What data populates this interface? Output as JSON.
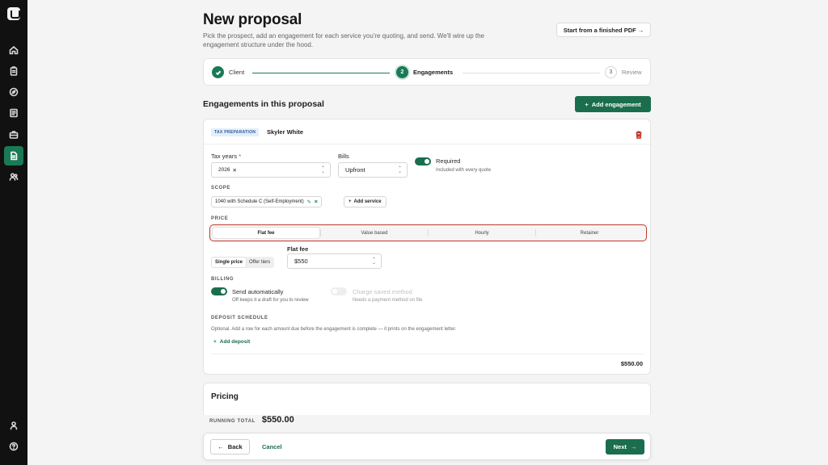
{
  "header": {
    "title": "New proposal",
    "subtitle": "Pick the prospect, add an engagement for each service you're quoting, and send. We'll wire up the engagement structure under the hood.",
    "pdf_button": "Start from a finished PDF →"
  },
  "stepper": {
    "steps": [
      {
        "label": "Client",
        "number": "",
        "state": "done"
      },
      {
        "label": "Engagements",
        "number": "2",
        "state": "current"
      },
      {
        "label": "Review",
        "number": "3",
        "state": "todo"
      }
    ]
  },
  "engagements": {
    "section_title": "Engagements in this proposal",
    "add_button": "Add engagement",
    "card": {
      "badge": "TAX PREPARATION",
      "client": "Skyler White",
      "tax_years_label": "Tax years",
      "tax_years_required_mark": "*",
      "tax_year_chip": "2026",
      "bills_label": "Bills",
      "bills_value": "Upfront",
      "required_label": "Required",
      "required_help": "Included with every quote",
      "scope_label": "SCOPE",
      "scope_chip": "1040 with Schedule C (Self-Employment)",
      "add_service": "Add service",
      "price_label": "PRICE",
      "price_tabs": [
        "Flat fee",
        "Value based",
        "Hourly",
        "Retainer"
      ],
      "price_tab_active": "Flat fee",
      "seg_options": [
        "Single price",
        "Offer tiers"
      ],
      "flat_fee_label": "Flat fee",
      "flat_fee_value": "$550",
      "billing_label": "BILLING",
      "send_auto_label": "Send automatically",
      "send_auto_help": "Off keeps it a draft for you to review",
      "charge_label": "Charge saved method",
      "charge_help": "Needs a payment method on file",
      "deposit_label": "DEPOSIT SCHEDULE",
      "deposit_help": "Optional. Add a row for each amount due before the engagement is complete — it prints on the engagement letter.",
      "add_deposit": "Add deposit",
      "total": "$550.00"
    }
  },
  "pricing": {
    "title": "Pricing",
    "running_label": "RUNNING TOTAL",
    "running_amount": "$550.00"
  },
  "footer": {
    "back": "Back",
    "cancel": "Cancel",
    "next": "Next"
  },
  "colors": {
    "accent": "#1a6e4d",
    "danger": "#c0392b",
    "sidebar": "#111111"
  },
  "sidebar_icons": [
    "logo-icon",
    "home-icon",
    "clipboard-icon",
    "compass-icon",
    "document-list-icon",
    "briefcase-icon",
    "proposal-doc-icon",
    "users-icon",
    "user-icon",
    "help-icon"
  ]
}
